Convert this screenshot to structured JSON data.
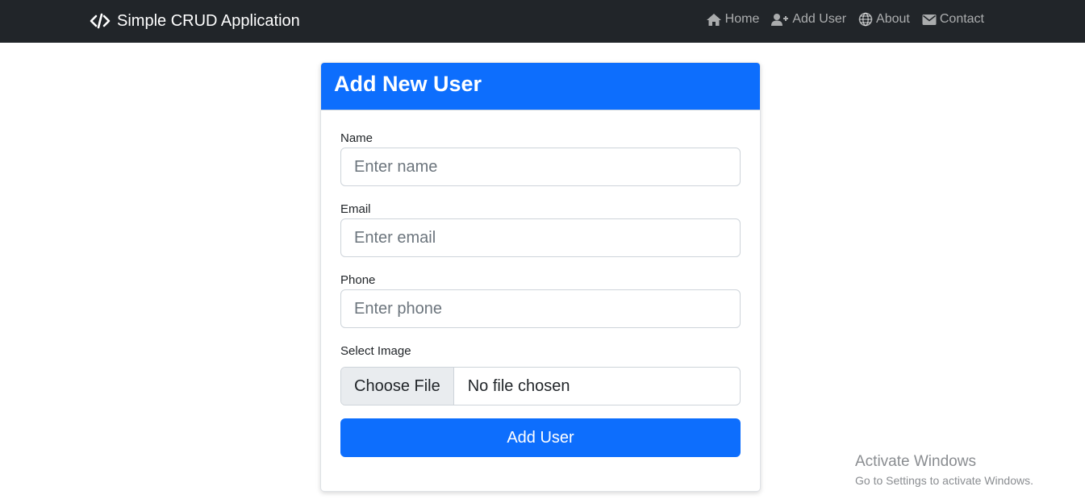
{
  "navbar": {
    "brand": "Simple CRUD Application",
    "brand_icon": "code-icon",
    "links": [
      {
        "label": "Home",
        "icon": "home-icon"
      },
      {
        "label": "Add User",
        "icon": "user-plus-icon"
      },
      {
        "label": "About",
        "icon": "globe-icon"
      },
      {
        "label": "Contact",
        "icon": "envelope-icon"
      }
    ]
  },
  "form": {
    "title": "Add New User",
    "name_label": "Name",
    "name_placeholder": "Enter name",
    "email_label": "Email",
    "email_placeholder": "Enter email",
    "phone_label": "Phone",
    "phone_placeholder": "Enter phone",
    "image_label": "Select Image",
    "choose_file": "Choose File",
    "file_status": "No file chosen",
    "submit_label": "Add User"
  },
  "watermark": {
    "title": "Activate Windows",
    "subtitle": "Go to Settings to activate Windows."
  },
  "colors": {
    "navbar_bg": "#212529",
    "primary": "#0d6efd"
  }
}
